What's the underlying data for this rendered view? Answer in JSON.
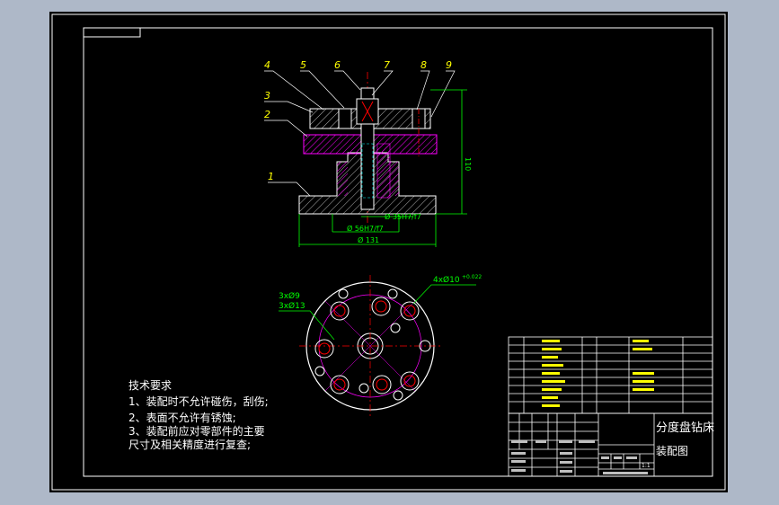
{
  "callouts": [
    "1",
    "2",
    "3",
    "4",
    "5",
    "6",
    "7",
    "8",
    "9"
  ],
  "dimensions": {
    "height": "110",
    "d_inner": "Ø 35H7/f7",
    "d_mid": "Ø 56H7/f7",
    "d_outer": "Ø 131",
    "holes_left_a": "3xØ9",
    "holes_left_b": "3xØ13",
    "holes_right": "4xØ10",
    "holes_right_tol": "+0.022"
  },
  "technical_requirements": {
    "heading": "技术要求",
    "lines": [
      "1、装配时不允许碰伤，刮伤;",
      "2、表面不允许有锈蚀;",
      "3、装配前应对零部件的主要",
      "尺寸及相关精度进行复查;"
    ]
  },
  "title_block": {
    "drawing_title_line1": "分度盘钻床",
    "drawing_title_line2": "装配图",
    "scale": "1:1"
  },
  "colors": {
    "background": "#000000",
    "screen_frame": "#aeb8c8",
    "outline": "#ffffff",
    "dimension": "#00ff00",
    "section_hatch": "#ff00ff",
    "callout": "#ffff00",
    "centerline": "#ff0000",
    "construction": "#ff00ff",
    "hidden_line": "#00ffff"
  }
}
